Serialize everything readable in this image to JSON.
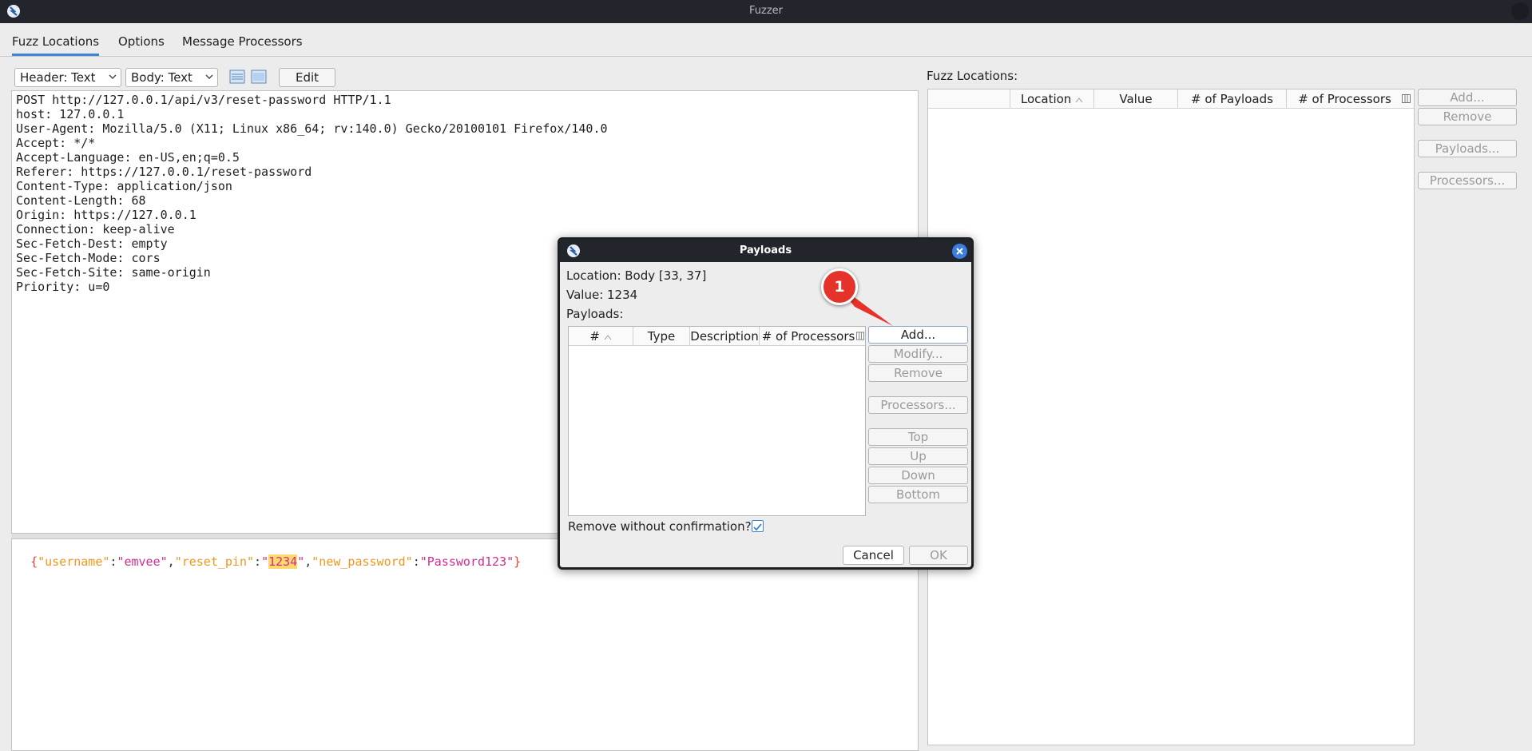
{
  "window": {
    "title": "Fuzzer"
  },
  "tabs": [
    {
      "label": "Fuzz Locations"
    },
    {
      "label": "Options"
    },
    {
      "label": "Message Processors"
    }
  ],
  "toolbar": {
    "header_view": "Header: Text",
    "body_view": "Body: Text",
    "edit_label": "Edit"
  },
  "request": {
    "header_lines": [
      "POST http://127.0.0.1/api/v3/reset-password HTTP/1.1",
      "host: 127.0.0.1",
      "User-Agent: Mozilla/5.0 (X11; Linux x86_64; rv:140.0) Gecko/20100101 Firefox/140.0",
      "Accept: */*",
      "Accept-Language: en-US,en;q=0.5",
      "Referer: https://127.0.0.1/reset-password",
      "Content-Type: application/json",
      "Content-Length: 68",
      "Origin: https://127.0.0.1",
      "Connection: keep-alive",
      "Sec-Fetch-Dest: empty",
      "Sec-Fetch-Mode: cors",
      "Sec-Fetch-Site: same-origin",
      "Priority: u=0"
    ],
    "body": {
      "open": "{",
      "k1": "\"username\"",
      "v1": "\"emvee\"",
      "k2": "\"reset_pin\"",
      "v2_q1": "\"",
      "v2": "1234",
      "v2_q2": "\"",
      "k3": "\"new_password\"",
      "v3": "\"Password123\"",
      "close": "}",
      "colon": ":",
      "comma": ","
    }
  },
  "fuzz_locations": {
    "label": "Fuzz Locations:",
    "columns": [
      "",
      "Location",
      "Value",
      "# of Payloads",
      "# of Processors"
    ],
    "buttons": {
      "add": "Add...",
      "remove": "Remove",
      "payloads": "Payloads...",
      "processors": "Processors..."
    }
  },
  "dialog": {
    "title": "Payloads",
    "location": "Location: Body [33, 37]",
    "value": "Value: 1234",
    "payloads_label": "Payloads:",
    "columns": [
      "#",
      "Type",
      "Description",
      "# of Processors"
    ],
    "buttons": {
      "add": "Add...",
      "modify": "Modify...",
      "remove": "Remove",
      "processors": "Processors...",
      "top": "Top",
      "up": "Up",
      "down": "Down",
      "bottom": "Bottom",
      "cancel": "Cancel",
      "ok": "OK"
    },
    "remove_confirm_label": "Remove without confirmation?",
    "remove_confirm_checked": true
  },
  "callout": {
    "number": "1"
  },
  "colors": {
    "accent": "#3a86d4",
    "callout": "#e5322b",
    "titlebar": "#22252b",
    "highlight": "#ffd96b"
  }
}
